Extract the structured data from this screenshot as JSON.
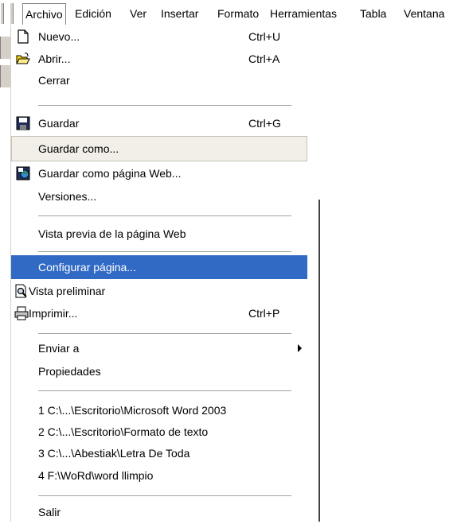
{
  "menubar": {
    "items": [
      {
        "label": "Archivo"
      },
      {
        "label": "Edición"
      },
      {
        "label": "Ver"
      },
      {
        "label": "Insertar"
      },
      {
        "label": "Formato"
      },
      {
        "label": "Herramientas"
      },
      {
        "label": "Tabla"
      },
      {
        "label": "Ventana"
      }
    ]
  },
  "file_menu": {
    "items": [
      {
        "label": "Nuevo...",
        "shortcut": "Ctrl+U",
        "icon": "new-document-icon"
      },
      {
        "label": "Abrir...",
        "shortcut": "Ctrl+A",
        "icon": "open-folder-icon"
      },
      {
        "label": "Cerrar"
      },
      {
        "label": "Guardar",
        "shortcut": "Ctrl+G",
        "icon": "save-disk-icon"
      },
      {
        "label": "Guardar como..."
      },
      {
        "label": "Guardar como página Web...",
        "icon": "save-web-icon"
      },
      {
        "label": "Versiones..."
      },
      {
        "label": "Vista previa de la página Web"
      },
      {
        "label": "Configurar página..."
      },
      {
        "label": "Vista preliminar",
        "icon": "print-preview-icon"
      },
      {
        "label": "Imprimir...",
        "shortcut": "Ctrl+P",
        "icon": "printer-icon"
      },
      {
        "label": "Enviar a",
        "submenu": true
      },
      {
        "label": "Propiedades"
      },
      {
        "label": "1 C:\\...\\Escritorio\\Microsoft  Word  2003"
      },
      {
        "label": "2 C:\\...\\Escritorio\\Formato de texto"
      },
      {
        "label": "3 C:\\...\\Abestiak\\Letra De Toda"
      },
      {
        "label": "4 F:\\WoRd\\word llimpio"
      },
      {
        "label": "Salir"
      }
    ]
  },
  "colors": {
    "selected_bg": "#316ac5",
    "hover_bg": "#f1efe8"
  }
}
